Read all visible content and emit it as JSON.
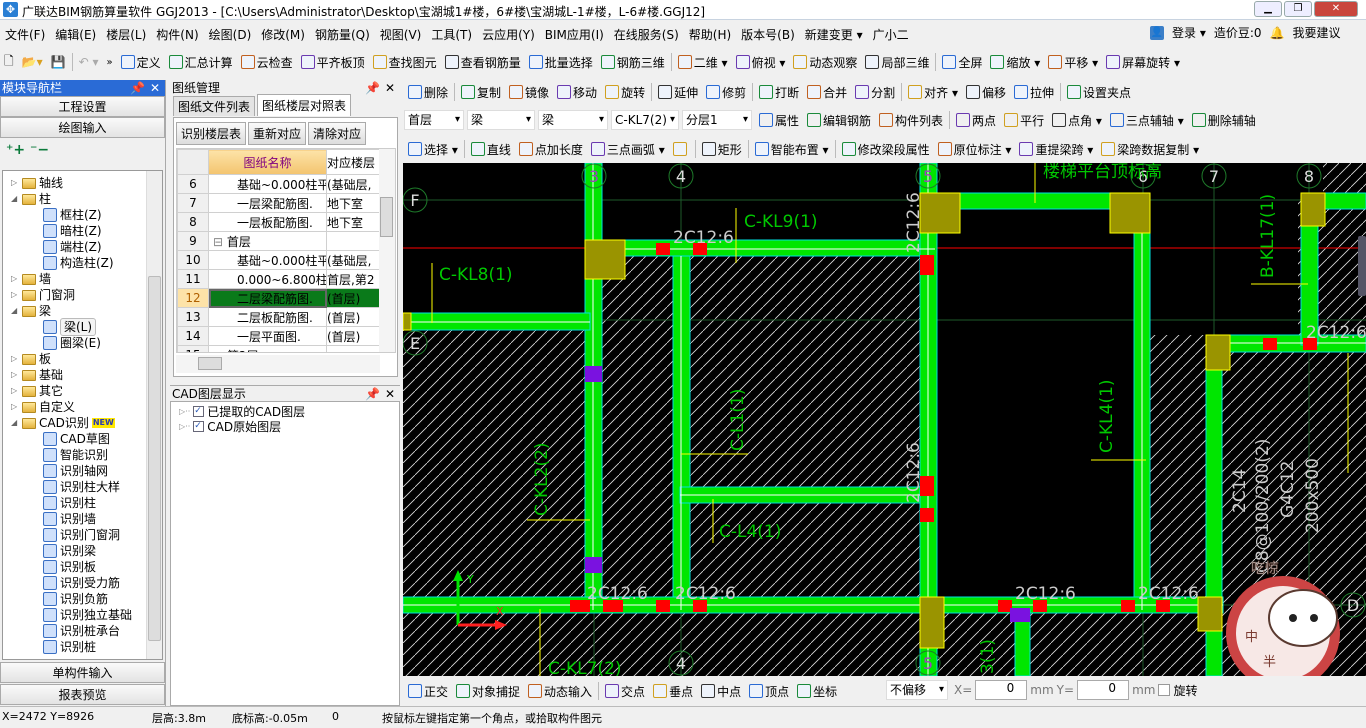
{
  "window": {
    "title": "广联达BIM钢筋算量软件 GGJ2013 - [C:\\Users\\Administrator\\Desktop\\宝湖城1#楼，6#楼\\宝湖城L-1#楼，L-6#楼.GGJ12]",
    "min": "▁",
    "max": "❐",
    "close": "✕"
  },
  "menu": [
    "文件(F)",
    "编辑(E)",
    "楼层(L)",
    "构件(N)",
    "绘图(D)",
    "修改(M)",
    "钢筋量(Q)",
    "视图(V)",
    "工具(T)",
    "云应用(Y)",
    "BIM应用(I)",
    "在线服务(S)",
    "帮助(H)",
    "版本号(B)",
    "新建变更 ▾",
    "广小二"
  ],
  "menu_right": {
    "login": "登录 ▾",
    "beans": "造价豆:0",
    "suggest": "我要建议"
  },
  "toolbar1": [
    "定义",
    "汇总计算",
    "云检查",
    "平齐板顶",
    "查找图元",
    "查看钢筋量",
    "批量选择",
    "钢筋三维",
    "二维 ▾",
    "俯视 ▾",
    "动态观察",
    "局部三维",
    "全屏",
    "缩放 ▾",
    "平移 ▾",
    "屏幕旋转 ▾"
  ],
  "toolbar2": [
    "删除",
    "复制",
    "镜像",
    "移动",
    "旋转",
    "延伸",
    "修剪",
    "打断",
    "合并",
    "分割",
    "对齐 ▾",
    "偏移",
    "拉伸",
    "设置夹点"
  ],
  "toolbar3": {
    "floor": "首层",
    "type": "梁",
    "subtype": "梁",
    "component": "C-KL7(2)",
    "layer": "分层1",
    "buttons": [
      "属性",
      "编辑钢筋",
      "构件列表",
      "两点",
      "平行",
      "点角 ▾",
      "三点辅轴 ▾",
      "删除辅轴"
    ]
  },
  "toolbar4": [
    "选择 ▾",
    "直线",
    "点加长度",
    "三点画弧 ▾",
    "",
    "矩形",
    "智能布置 ▾",
    "修改梁段属性",
    "原位标注 ▾",
    "重提梁跨 ▾",
    "梁跨数据复制 ▾"
  ],
  "nav": {
    "title": "模块导航栏",
    "project_settings": "工程设置",
    "drawing_input": "绘图输入",
    "single_input": "单构件输入",
    "report_preview": "报表预览",
    "tree": [
      {
        "label": "轴线",
        "level": 0,
        "state": "closed"
      },
      {
        "label": "柱",
        "level": 0,
        "state": "open"
      },
      {
        "label": "框柱(Z)",
        "level": 1
      },
      {
        "label": "暗柱(Z)",
        "level": 1
      },
      {
        "label": "端柱(Z)",
        "level": 1
      },
      {
        "label": "构造柱(Z)",
        "level": 1
      },
      {
        "label": "墙",
        "level": 0,
        "state": "closed"
      },
      {
        "label": "门窗洞",
        "level": 0,
        "state": "closed"
      },
      {
        "label": "梁",
        "level": 0,
        "state": "open"
      },
      {
        "label": "梁(L)",
        "level": 1,
        "selected": true
      },
      {
        "label": "圈梁(E)",
        "level": 1
      },
      {
        "label": "板",
        "level": 0,
        "state": "closed"
      },
      {
        "label": "基础",
        "level": 0,
        "state": "closed"
      },
      {
        "label": "其它",
        "level": 0,
        "state": "closed"
      },
      {
        "label": "自定义",
        "level": 0,
        "state": "closed"
      },
      {
        "label": "CAD识别",
        "level": 0,
        "state": "open",
        "badge": "NEW"
      },
      {
        "label": "CAD草图",
        "level": 1
      },
      {
        "label": "智能识别",
        "level": 1
      },
      {
        "label": "识别轴网",
        "level": 1
      },
      {
        "label": "识别柱大样",
        "level": 1
      },
      {
        "label": "识别柱",
        "level": 1
      },
      {
        "label": "识别墙",
        "level": 1
      },
      {
        "label": "识别门窗洞",
        "level": 1
      },
      {
        "label": "识别梁",
        "level": 1
      },
      {
        "label": "识别板",
        "level": 1
      },
      {
        "label": "识别受力筋",
        "level": 1
      },
      {
        "label": "识别负筋",
        "level": 1
      },
      {
        "label": "识别独立基础",
        "level": 1
      },
      {
        "label": "识别桩承台",
        "level": 1
      },
      {
        "label": "识别桩",
        "level": 1
      }
    ]
  },
  "drawings": {
    "title": "图纸管理",
    "tabs": [
      "图纸文件列表",
      "图纸楼层对照表"
    ],
    "active_tab": 1,
    "buttons": [
      "识别楼层表",
      "重新对应",
      "清除对应"
    ],
    "columns": [
      "",
      "图纸名称",
      "对应楼层"
    ],
    "rows": [
      {
        "n": "6",
        "name": "基础~0.000柱平",
        "floor": "(基础层,",
        "indent": 2
      },
      {
        "n": "7",
        "name": "一层梁配筋图.",
        "floor": "地下室",
        "indent": 2
      },
      {
        "n": "8",
        "name": "一层板配筋图.",
        "floor": "地下室",
        "indent": 2
      },
      {
        "n": "9",
        "name": "首层",
        "floor": "",
        "indent": 1,
        "group": true
      },
      {
        "n": "10",
        "name": "基础~0.000柱平",
        "floor": "(基础层,",
        "indent": 2
      },
      {
        "n": "11",
        "name": "0.000~6.800柱",
        "floor": "首层,第2",
        "indent": 2
      },
      {
        "n": "12",
        "name": "二层梁配筋图.",
        "floor": "(首层)",
        "indent": 2,
        "selected": true
      },
      {
        "n": "13",
        "name": "二层板配筋图.",
        "floor": "(首层)",
        "indent": 2
      },
      {
        "n": "14",
        "name": "一层平面图.",
        "floor": "(首层)",
        "indent": 2
      },
      {
        "n": "15",
        "name": "第2层",
        "floor": "",
        "indent": 1,
        "group": true
      }
    ]
  },
  "cad_layers": {
    "title": "CAD图层显示",
    "items": [
      "已提取的CAD图层",
      "CAD原始图层"
    ]
  },
  "canvas": {
    "grid": {
      "F": "F",
      "E": "E",
      "D": "D",
      "3": "3",
      "4": "4",
      "5": "5",
      "6": "6",
      "7": "7",
      "8": "8"
    },
    "labels": {
      "kl8": "C-KL8(1)",
      "kl9": "C-KL9(1)",
      "l1": "C-L1(1)",
      "kl2": "C-KL2(2)",
      "l4": "C-L4(1)",
      "kl7": "C-KL7(2)",
      "kl4": "C-KL4(1)",
      "bkl17": "B-KL17(1)",
      "rebar": "2C12:6",
      "a1": "2C14",
      "a2": "C8@100/200(2)",
      "a3": "G4C12",
      "a4": "200x500",
      "top": "楼梯平台顶标高",
      "partial": "3(1)",
      "axis_x": "X",
      "axis_y": "Y",
      "sticker": "吃惊",
      "sticker_a": "中",
      "sticker_b": "半"
    },
    "colors": {
      "beam": "#00e600",
      "column": "#9a9400",
      "rebar": "#ff0000",
      "background": "#000000"
    }
  },
  "bottom_toolbar": {
    "items": [
      "正交",
      "对象捕捉",
      "动态输入",
      "交点",
      "垂点",
      "中点",
      "顶点",
      "坐标"
    ],
    "offset": "不偏移",
    "x_label": "X=",
    "x_value": "0",
    "y_label": "Y=",
    "y_value": "0",
    "unit": "mm",
    "rotate": "旋转"
  },
  "status": {
    "coords": "X=2472 Y=8926",
    "floor_height": "层高:3.8m",
    "base_elev": "底标高:-0.05m",
    "value": "0",
    "message": "按鼠标左键指定第一个角点，或拾取构件图元"
  }
}
